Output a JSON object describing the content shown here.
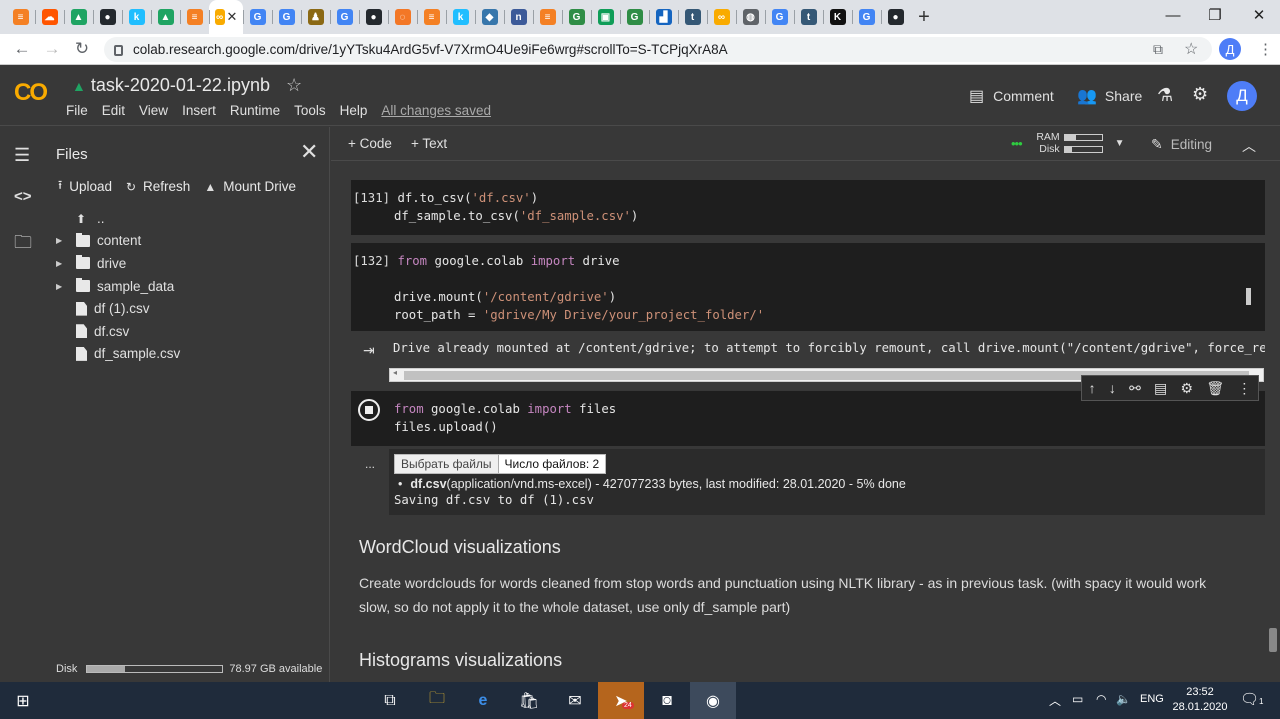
{
  "browser": {
    "tabs": [
      {
        "icon": "stackoverflow-icon",
        "color": "#f48024",
        "glyph": "≡"
      },
      {
        "icon": "soundcloud-icon",
        "color": "#f50",
        "glyph": "☁"
      },
      {
        "icon": "google-drive-icon",
        "color": "#1fa463",
        "glyph": "▲"
      },
      {
        "icon": "github-icon",
        "color": "#24292e",
        "glyph": "●"
      },
      {
        "icon": "kaggle-icon",
        "color": "#20beff",
        "glyph": "k"
      },
      {
        "icon": "google-drive-icon",
        "color": "#1fa463",
        "glyph": "▲"
      },
      {
        "icon": "stackoverflow-icon",
        "color": "#f48024",
        "glyph": "≡"
      },
      {
        "icon": "google-icon",
        "color": "#4285f4",
        "glyph": "G"
      },
      {
        "icon": "google-icon",
        "color": "#4285f4",
        "glyph": "G"
      },
      {
        "icon": "pandas-icon",
        "color": "#8b6914",
        "glyph": "♟"
      },
      {
        "icon": "google-icon",
        "color": "#4285f4",
        "glyph": "G"
      },
      {
        "icon": "github-icon",
        "color": "#24292e",
        "glyph": "●"
      },
      {
        "icon": "jupyter-icon",
        "color": "#f37726",
        "glyph": "◌"
      },
      {
        "icon": "stackoverflow-icon",
        "color": "#f48024",
        "glyph": "≡"
      },
      {
        "icon": "kaggle-icon",
        "color": "#20beff",
        "glyph": "k"
      },
      {
        "icon": "python-icon",
        "color": "#3776ab",
        "glyph": "◆"
      },
      {
        "icon": "notion-icon",
        "color": "#3c5a99",
        "glyph": "n"
      },
      {
        "icon": "stackoverflow-icon",
        "color": "#f48024",
        "glyph": "≡"
      },
      {
        "icon": "geeksforgeeks-icon",
        "color": "#2f8d46",
        "glyph": "G"
      },
      {
        "icon": "green-app-icon",
        "color": "#0f9d58",
        "glyph": "▣"
      },
      {
        "icon": "geeksforgeeks-icon",
        "color": "#2f8d46",
        "glyph": "G"
      },
      {
        "icon": "chart-icon",
        "color": "#1565c0",
        "glyph": "▟"
      },
      {
        "icon": "tds-icon",
        "color": "#355876",
        "glyph": "t"
      },
      {
        "icon": "colab-icon",
        "color": "#f9ab00",
        "glyph": "∞"
      },
      {
        "icon": "globe-icon",
        "color": "#5f6368",
        "glyph": "◍"
      },
      {
        "icon": "google-icon",
        "color": "#4285f4",
        "glyph": "G"
      },
      {
        "icon": "tds-icon",
        "color": "#355876",
        "glyph": "t"
      },
      {
        "icon": "k-icon",
        "color": "#111",
        "glyph": "K"
      },
      {
        "icon": "google-icon",
        "color": "#4285f4",
        "glyph": "G"
      },
      {
        "icon": "github-icon",
        "color": "#24292e",
        "glyph": "●"
      }
    ],
    "url": "colab.research.google.com/drive/1yYTsku4ArdG5vf-V7XrmO4Ue9iFe6wrg#scrollTo=S-TCPjqXrA8A",
    "avatar": "Д"
  },
  "colab": {
    "notebook_title": "task-2020-01-22.ipynb",
    "menu": [
      "File",
      "Edit",
      "View",
      "Insert",
      "Runtime",
      "Tools",
      "Help"
    ],
    "saved_status": "All changes saved",
    "comment_label": "Comment",
    "share_label": "Share",
    "avatar": "Д",
    "add_code": "+ Code",
    "add_text": "+ Text",
    "ram_label": "RAM",
    "disk_label": "Disk",
    "ram_usage": 0.3,
    "disk_usage_bar": 0.2,
    "editing_label": "Editing"
  },
  "files_panel": {
    "title": "Files",
    "upload": "Upload",
    "refresh": "Refresh",
    "mount": "Mount Drive",
    "items": [
      {
        "name": "..",
        "type": "up"
      },
      {
        "name": "content",
        "type": "folder"
      },
      {
        "name": "drive",
        "type": "folder"
      },
      {
        "name": "sample_data",
        "type": "folder"
      },
      {
        "name": "df (1).csv",
        "type": "file"
      },
      {
        "name": "df.csv",
        "type": "file"
      },
      {
        "name": "df_sample.csv",
        "type": "file"
      }
    ],
    "disk_label": "Disk",
    "disk_usage": 0.28,
    "disk_available": "78.97 GB available"
  },
  "cells": {
    "c131_prompt": "[131]",
    "c131_l1a": "df.to_csv(",
    "c131_l1s": "'df.csv'",
    "c131_l1b": ")",
    "c131_l2a": "df_sample.to_csv(",
    "c131_l2s": "'df_sample.csv'",
    "c131_l2b": ")",
    "c132_prompt": "[132]",
    "c132_from": "from",
    "c132_mod": " google.colab ",
    "c132_import": "import",
    "c132_name": " drive",
    "c132_l3a": "drive.mount(",
    "c132_l3s": "'/content/gdrive'",
    "c132_l3b": ")",
    "c132_l4a": "root_path = ",
    "c132_l4s": "'gdrive/My Drive/your_project_folder/'",
    "c132_output": "Drive already mounted at /content/gdrive; to attempt to forcibly remount, call drive.mount(\"/content/gdrive\", force_remou",
    "c133_from": "from",
    "c133_mod": " google.colab ",
    "c133_import": "import",
    "c133_name": " files",
    "c133_l2": "files.upload()",
    "upload_more": "...",
    "choose_files": "Выбрать файлы",
    "file_count": "Число файлов: 2",
    "upload_file_name": "df.csv",
    "upload_file_info": "(application/vnd.ms-excel) - 427077233 bytes, last modified: 28.01.2020 - 5% done",
    "saving_line": "Saving df.csv to df (1).csv"
  },
  "markdown": {
    "h_wordcloud": "WordCloud visualizations",
    "p_wordcloud": "Create wordclouds for words cleaned from stop words and punctuation using NLTK library - as in previous task. (with spacy it would work slow, so do not apply it to the whole dataset, use only df_sample part)",
    "h_hist": "Histograms visualizations"
  },
  "taskbar": {
    "language": "ENG",
    "time": "23:52",
    "date": "28.01.2020",
    "notification_count": "1",
    "telegram_badge": "24"
  }
}
